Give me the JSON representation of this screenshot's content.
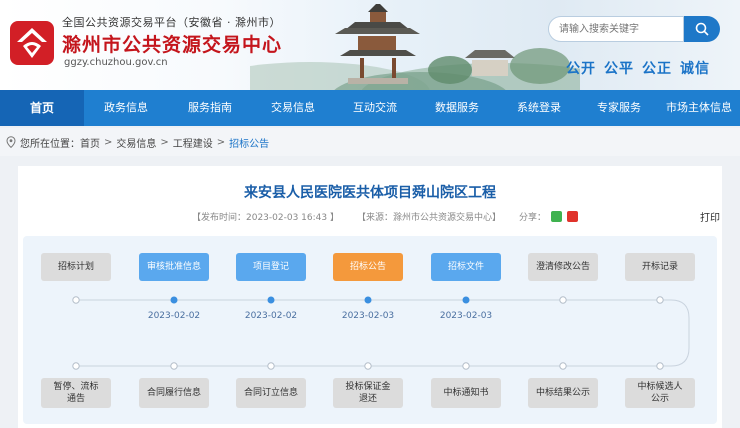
{
  "header": {
    "platform_line": "全国公共资源交易平台（安徽省 · 滁州市）",
    "site_title": "滁州市公共资源交易中心",
    "domain": "ggzy.chuzhou.gov.cn",
    "search_placeholder": "请输入搜索关键字",
    "slogans": [
      "公开",
      "公平",
      "公正",
      "诚信"
    ]
  },
  "nav": {
    "items": [
      "首页",
      "政务信息",
      "服务指南",
      "交易信息",
      "互动交流",
      "数据服务",
      "系统登录",
      "专家服务",
      "市场主体信息"
    ],
    "active_index": 0
  },
  "breadcrumb": {
    "prefix": "您所在位置：",
    "items": [
      "首页",
      "交易信息",
      "工程建设"
    ],
    "current": "招标公告"
  },
  "article": {
    "title": "来安县人民医院医共体项目舜山院区工程",
    "publish_time": "【发布时间：2023-02-03 16:43 】",
    "source": "【来源：滁州市公共资源交易中心】",
    "share_label": "分享：",
    "print_label": "打印"
  },
  "flow": {
    "top_steps": [
      {
        "label": "招标计划",
        "state": "gray",
        "date": ""
      },
      {
        "label": "审核批准信息",
        "state": "blue",
        "date": "2023-02-02"
      },
      {
        "label": "项目登记",
        "state": "blue",
        "date": "2023-02-02"
      },
      {
        "label": "招标公告",
        "state": "orange",
        "date": "2023-02-03"
      },
      {
        "label": "招标文件",
        "state": "blue",
        "date": "2023-02-03"
      },
      {
        "label": "澄清修改公告",
        "state": "gray",
        "date": ""
      },
      {
        "label": "开标记录",
        "state": "gray",
        "date": ""
      }
    ],
    "bottom_steps": [
      {
        "label": "暂停、流标\n通告",
        "state": "gray"
      },
      {
        "label": "合同履行信息",
        "state": "gray"
      },
      {
        "label": "合同订立信息",
        "state": "gray"
      },
      {
        "label": "投标保证金\n退还",
        "state": "gray"
      },
      {
        "label": "中标通知书",
        "state": "gray"
      },
      {
        "label": "中标结果公示",
        "state": "gray"
      },
      {
        "label": "中标候选人\n公示",
        "state": "gray"
      }
    ]
  },
  "colors": {
    "nav_blue": "#1f7fd0",
    "title_red": "#c4151c",
    "step_blue": "#5aa8ee",
    "step_orange": "#f4993c",
    "step_gray": "#dcdcdc"
  }
}
